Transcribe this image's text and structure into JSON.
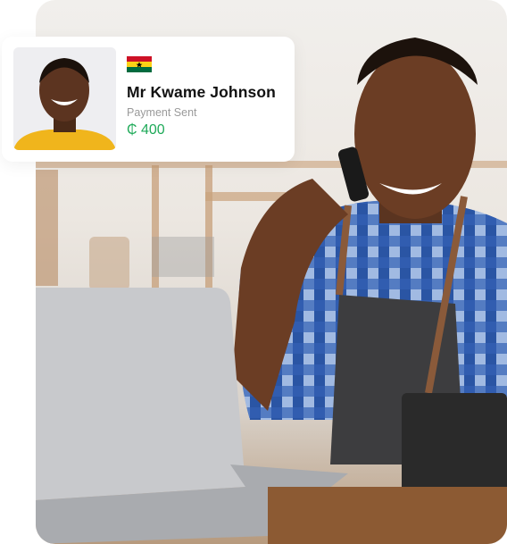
{
  "photo": {
    "icon": "man-on-phone-with-laptop-photo"
  },
  "card": {
    "avatar_icon": "person-portrait",
    "flag_icon": "ghana-flag",
    "name": "Mr Kwame Johnson",
    "status": "Payment Sent",
    "amount": "₵ 400",
    "amount_color": "#1faa59"
  }
}
